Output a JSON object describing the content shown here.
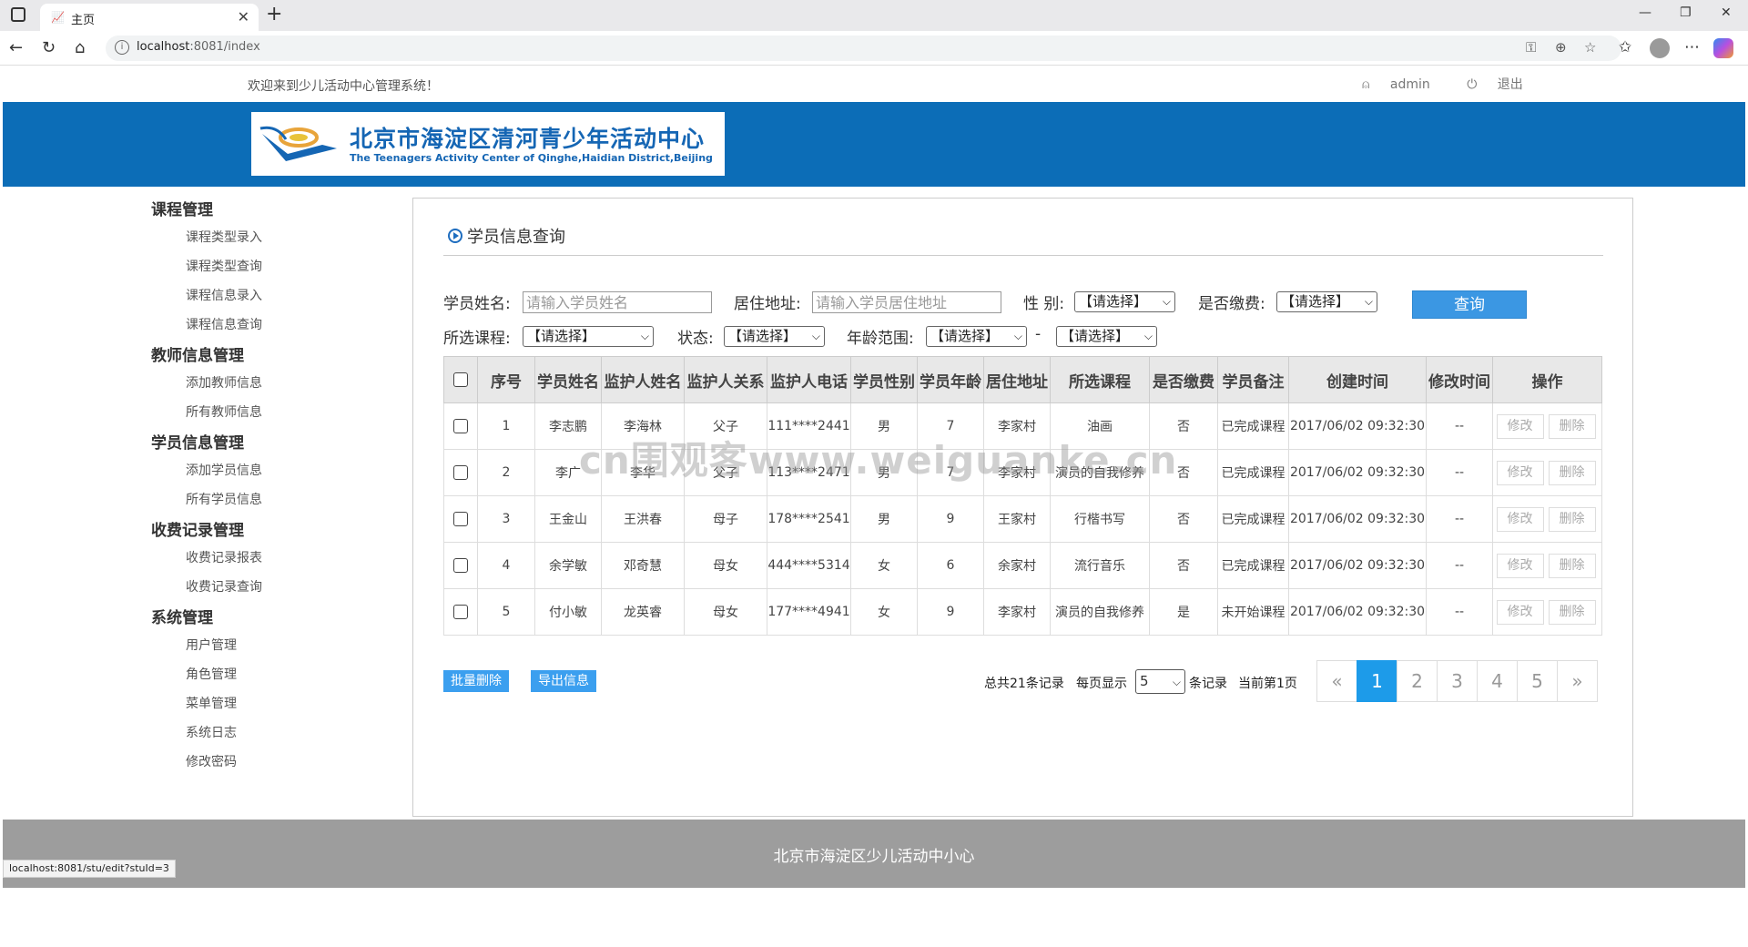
{
  "browser": {
    "tab_title": "主页",
    "url_host": "localhost",
    "url_rest": ":8081/index"
  },
  "header": {
    "welcome": "欢迎来到少儿活动中心管理系统！",
    "username": "admin",
    "logout": "退出",
    "logo_cn": "北京市海淀区清河青少年活动中心",
    "logo_en": "The Teenagers Activity Center of Qinghe,Haidian District,Beijing"
  },
  "sidebar": {
    "groups": [
      {
        "title": "课程管理",
        "items": [
          "课程类型录入",
          "课程类型查询",
          "课程信息录入",
          "课程信息查询"
        ]
      },
      {
        "title": "教师信息管理",
        "items": [
          "添加教师信息",
          "所有教师信息"
        ]
      },
      {
        "title": "学员信息管理",
        "items": [
          "添加学员信息",
          "所有学员信息"
        ]
      },
      {
        "title": "收费记录管理",
        "items": [
          "收费记录报表",
          "收费记录查询"
        ]
      },
      {
        "title": "系统管理",
        "items": [
          "用户管理",
          "角色管理",
          "菜单管理",
          "系统日志",
          "修改密码"
        ]
      }
    ]
  },
  "main": {
    "section_title": "学员信息查询",
    "filters": {
      "name_label": "学员姓名:",
      "name_placeholder": "请输入学员姓名",
      "addr_label": "居住地址:",
      "addr_placeholder": "请输入学员居住地址",
      "gender_label": "性 别:",
      "gender_value": "【请选择】",
      "paid_label": "是否缴费:",
      "paid_value": "【请选择】",
      "course_label": "所选课程:",
      "course_value": "【请选择】",
      "status_label": "状态:",
      "status_value": "【请选择】",
      "age_label": "年龄范围:",
      "age_from": "【请选择】",
      "age_sep": "-",
      "age_to": "【请选择】",
      "query_button": "查询"
    },
    "table": {
      "headers": [
        "序号",
        "学员姓名",
        "监护人姓名",
        "监护人关系",
        "监护人电话",
        "学员性别",
        "学员年龄",
        "居住地址",
        "所选课程",
        "是否缴费",
        "学员备注",
        "创建时间",
        "修改时间",
        "操作"
      ],
      "rows": [
        [
          "1",
          "李志鹏",
          "李海林",
          "父子",
          "111****2441",
          "男",
          "7",
          "李家村",
          "油画",
          "否",
          "已完成课程",
          "2017/06/02 09:32:30",
          "--"
        ],
        [
          "2",
          "李广",
          "李华",
          "父子",
          "113****2471",
          "男",
          "7",
          "李家村",
          "演员的自我修养",
          "否",
          "已完成课程",
          "2017/06/02 09:32:30",
          "--"
        ],
        [
          "3",
          "王金山",
          "王洪春",
          "母子",
          "178****2541",
          "男",
          "9",
          "王家村",
          "行楷书写",
          "否",
          "已完成课程",
          "2017/06/02 09:32:30",
          "--"
        ],
        [
          "4",
          "余学敏",
          "邓奇慧",
          "母女",
          "444****5314",
          "女",
          "6",
          "余家村",
          "流行音乐",
          "否",
          "已完成课程",
          "2017/06/02 09:32:30",
          "--"
        ],
        [
          "5",
          "付小敏",
          "龙英睿",
          "母女",
          "177****4941",
          "女",
          "9",
          "李家村",
          "演员的自我修养",
          "是",
          "未开始课程",
          "2017/06/02 09:32:30",
          "--"
        ]
      ],
      "edit_label": "修改",
      "delete_label": "删除"
    },
    "batch_delete": "批量删除",
    "export": "导出信息",
    "pagination": {
      "total_text": "总共21条记录",
      "per_page_label": "每页显示",
      "per_page_value": "5",
      "records_label": "条记录",
      "current_text": "当前第1页",
      "prev": "«",
      "pages": [
        "1",
        "2",
        "3",
        "4",
        "5"
      ],
      "next": "»"
    }
  },
  "footer": {
    "text": "北京市海淀区少儿活动中小心"
  },
  "statusbar": {
    "text": "localhost:8081/stu/edit?stuId=3"
  },
  "watermark": {
    "text": "cn围观客www.weiguanke.cn"
  },
  "colors": {
    "banner": "#0c6db7",
    "accent": "#3b97e3",
    "footer": "#9d9d9d"
  }
}
